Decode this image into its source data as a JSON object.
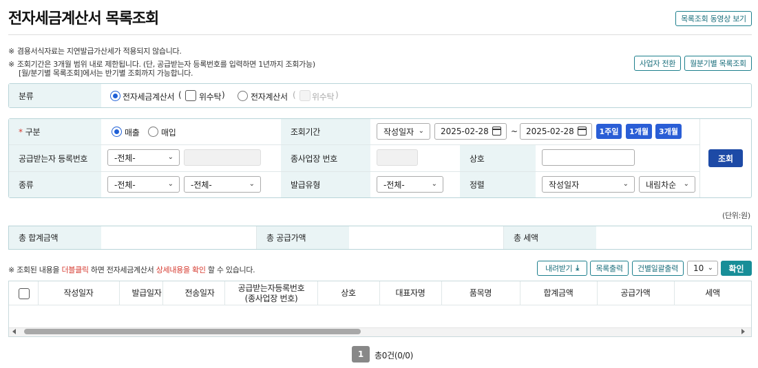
{
  "page": {
    "title": "전자세금계산서 목록조회",
    "video_button": "목록조회 동영상 보기",
    "switch_business": "사업자 전환",
    "by_period_button": "월분기별 목록조회"
  },
  "notes": {
    "mark": "※",
    "line1": "겸용서식자료는 지연발급가산세가 적용되지 않습니다.",
    "line2": "조회기간은 3개월 범위 내로 제한됩니다. (단, 공급받는자 등록번호를 입력하면 1년까지 조회가능)",
    "line3": "[월/분기별 목록조회]에서는 반기별 조회까지 가능합니다."
  },
  "category": {
    "label": "분류",
    "opt1": "전자세금계산서",
    "paren_open": "(",
    "opt1_sub": "위수탁",
    "paren_close": ")",
    "opt2": "전자계산서",
    "opt2_sub": "위수탁"
  },
  "search": {
    "type_label": "구분",
    "required_mark": "*",
    "sale": "매출",
    "purchase": "매입",
    "period_label": "조회기간",
    "date_type": "작성일자",
    "date_from": "2025-02-28",
    "tilde": "~",
    "date_to": "2025-02-28",
    "week": "1주일",
    "month1": "1개월",
    "month3": "3개월",
    "receiver_label": "공급받는자 등록번호",
    "receiver_select": "-전체-",
    "branch_label": "종사업장 번호",
    "company_label": "상호",
    "kind_label": "종류",
    "kind1": "-전체-",
    "kind2": "-전체-",
    "issue_type_label": "발급유형",
    "issue_type": "-전체-",
    "sort_label": "정렬",
    "sort_field": "작성일자",
    "sort_order": "내림차순",
    "search_button": "조회"
  },
  "totals": {
    "unit": "(단위:원)",
    "total_label": "총 합계금액",
    "supply_label": "총 공급가액",
    "tax_label": "총 세액"
  },
  "list": {
    "hint_pre": "※ 조회된 내용을 ",
    "hint_dbl": "더블클릭",
    "hint_mid": " 하면 전자세금계산서 ",
    "hint_detail": "상세내용을 확인",
    "hint_post": " 할 수 있습니다.",
    "download": "내려받기",
    "print_list": "목록출력",
    "print_each": "건별일괄출력",
    "page_size": "10",
    "confirm": "확인",
    "columns": [
      "작성일자",
      "발급일자",
      "전송일자",
      "공급받는자등록번호\n(종사업장 번호)",
      "상호",
      "대표자명",
      "품목명",
      "합계금액",
      "공급가액",
      "세액"
    ]
  },
  "pagination": {
    "current": "1",
    "summary": "총0건(0/0)"
  },
  "colors": {
    "accent": "#2a5ed6",
    "teal": "#188e98",
    "label_bg": "#eaf4f5",
    "red": "#d63a2f"
  }
}
